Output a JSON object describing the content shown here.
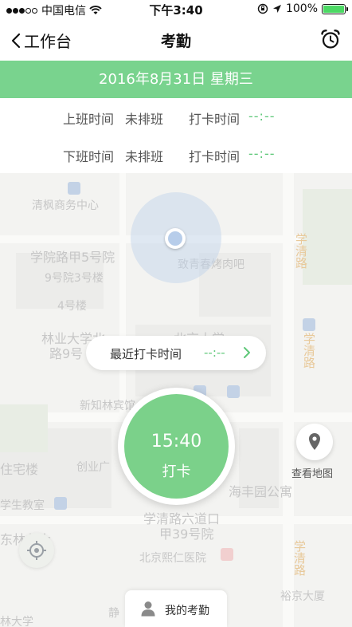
{
  "status_bar": {
    "carrier": "中国电信",
    "time": "下午3:40",
    "battery": "100%"
  },
  "nav": {
    "back_label": "工作台",
    "title": "考勤",
    "alarm_icon": "alarm-clock-icon"
  },
  "date_banner": "2016年8月31日 星期三",
  "schedule": {
    "rows": [
      {
        "label": "上班时间",
        "status": "未排班",
        "punch_label": "打卡时间",
        "punch_value": "--:--"
      },
      {
        "label": "下班时间",
        "status": "未排班",
        "punch_label": "打卡时间",
        "punch_value": "--:--"
      }
    ]
  },
  "map": {
    "labels": {
      "l1": "清枫商务中心",
      "l2": "学院路甲5号院",
      "l3": "9号院3号楼",
      "l4": "4号楼",
      "l5": "林业大学北",
      "l6": "路9号",
      "l7": "北京大学",
      "l8": "致青春烤肉吧",
      "l9": "新知林宾馆",
      "l10": "住宅楼",
      "l11": "创业广",
      "l12": "学生教室",
      "l13": "学清路六道口",
      "l14": "甲39号院",
      "l15": "北京熙仁医院",
      "l16": "海丰园公寓",
      "l17": "裕京大厦",
      "l18": "东林业大",
      "l19": "静",
      "l20": "林大学",
      "v1": "学清路",
      "v2": "学清路",
      "v3": "学清路"
    }
  },
  "recent_punch": {
    "label": "最近打卡时间",
    "value": "--:--"
  },
  "punch_button": {
    "time": "15:40",
    "label": "打卡"
  },
  "view_map_label": "查看地图",
  "my_attendance_label": "我的考勤",
  "colors": {
    "accent": "#79d38e",
    "accent_text": "#5fc879"
  }
}
